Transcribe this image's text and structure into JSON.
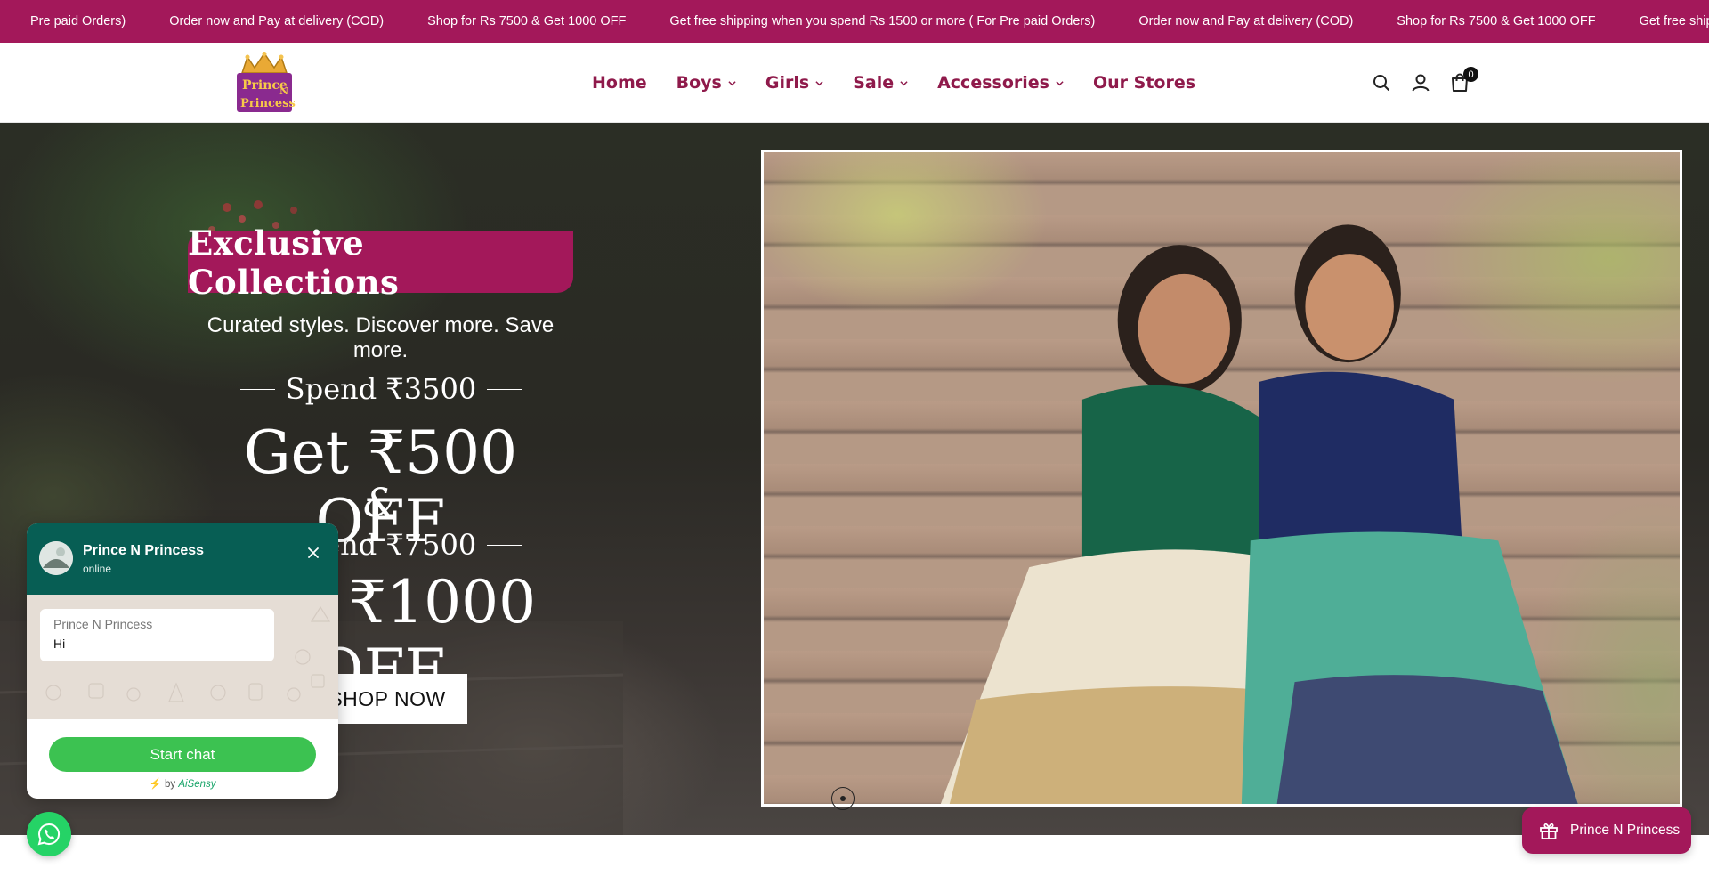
{
  "announcement": {
    "items": [
      "Pre paid Orders)",
      "Order now and Pay at delivery (COD)",
      "Shop for Rs 7500 & Get 1000 OFF",
      "Get free shipping when you spend Rs 1500 or more ( For Pre paid Orders)",
      "Order now and Pay at delivery (COD)",
      "Shop for Rs 7500 & Get 1000 OFF",
      "Get free shipping wl"
    ],
    "background": "#a3185a"
  },
  "header": {
    "logo": {
      "line1": "Prince",
      "line2": "N",
      "line3": "Princess"
    },
    "nav": [
      {
        "label": "Home",
        "has_dropdown": false
      },
      {
        "label": "Boys",
        "has_dropdown": true
      },
      {
        "label": "Girls",
        "has_dropdown": true
      },
      {
        "label": "Sale",
        "has_dropdown": true
      },
      {
        "label": "Accessories",
        "has_dropdown": true
      },
      {
        "label": "Our Stores",
        "has_dropdown": false
      }
    ],
    "cart_count": "0",
    "icons": [
      "search-icon",
      "account-icon",
      "cart-icon"
    ]
  },
  "hero": {
    "badge": "Exclusive Collections",
    "subhead": "Curated styles. Discover more. Save more.",
    "spend1": "Spend ₹3500",
    "offer1": "Get ₹500 OFF",
    "ampersand": "&",
    "spend2": "Spend ₹7500",
    "offer2": "Get ₹1000 OFF",
    "cta": "SHOP NOW"
  },
  "chat": {
    "name": "Prince N Princess",
    "status": "online",
    "bubble_from": "Prince N Princess",
    "bubble_message": "Hi",
    "start_label": "Start chat",
    "powered_prefix": "⚡ by ",
    "powered_brand": "AiSensy",
    "header_color": "#075e54",
    "button_color": "#3cc251"
  },
  "rewards": {
    "label": "Prince N Princess"
  },
  "colors": {
    "brand": "#a3185a",
    "nav_text": "#8f1a4b"
  }
}
